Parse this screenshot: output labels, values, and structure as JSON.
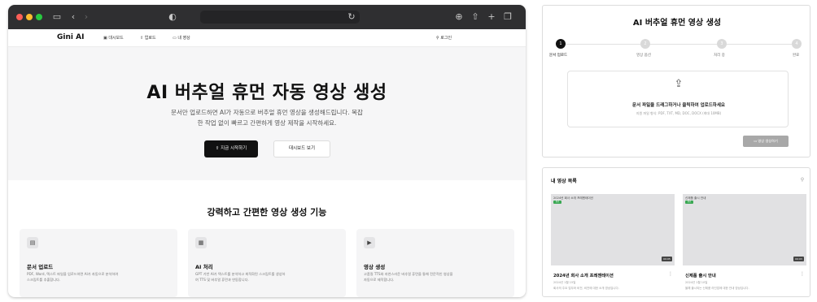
{
  "browser": {
    "nav": {
      "brand": "Gini AI",
      "links": [
        "대시보드",
        "업로드",
        "내 영상"
      ],
      "login": "로그인"
    },
    "hero": {
      "title": "AI 버추얼 휴먼 자동 영상 생성",
      "desc_line1": "문서만 업로드하면 AI가 자동으로 버추얼 휴먼 영상을 생성해드립니다. 복잡",
      "desc_line2": "한 작업 없이 빠르고 간편하게 영상 제작을 시작하세요.",
      "primary_button": "지금 시작하기",
      "secondary_button": "대시보드 보기"
    },
    "features": {
      "title": "강력하고 간편한 영상 생성 기능",
      "cards": [
        {
          "icon": "document-icon",
          "title": "문서 업로드",
          "desc1": "PDF, Word, 텍스트 파일을 업로드하면 AI가 자동으로 분석하여",
          "desc2": "스크립트를 추출합니다."
        },
        {
          "icon": "chip-icon",
          "title": "AI 처리",
          "desc1": "GPT 기반 AI가 텍스트를 분석하고 최적화된 스크립트를 생성하",
          "desc2": "여 TTS 및 버추얼 휴먼과 연동합니다."
        },
        {
          "icon": "video-icon",
          "title": "영상 생성",
          "desc1": "고품질 TTS와 자연스러운 버추얼 휴먼을 통해 전문적인 영상을",
          "desc2": "자동으로 제작합니다."
        }
      ]
    }
  },
  "upload": {
    "title": "AI 버추얼 휴먼 영상 생성",
    "steps": [
      {
        "num": "1",
        "label": "문서 업로드",
        "active": true
      },
      {
        "num": "2",
        "label": "영상 옵션",
        "active": false
      },
      {
        "num": "3",
        "label": "처리 중",
        "active": false
      },
      {
        "num": "4",
        "label": "완료",
        "active": false
      }
    ],
    "drop_text": "문서 파일을 드래그하거나 클릭하여 업로드하세요",
    "drop_sub": "지원 파일 형식: PDF, TXT, MD, DOC, DOCX (최대 10MB)",
    "generate_button": "영상 생성하기"
  },
  "video_list": {
    "title": "내 영상 목록",
    "videos": [
      {
        "thumb_label": "2024년 회사 소개 프레젠테이션",
        "badge": "완료",
        "duration": "00:05",
        "title": "2024년 회사 소개 프레젠테이션",
        "date": "2024년 1월 15일",
        "desc": "회사의 주요 업무와 비전, 비전에 대한 소개 영상입니다."
      },
      {
        "thumb_label": "신제품 출시 안내",
        "badge": "완료",
        "duration": "00:03",
        "title": "신제품 출시 안내",
        "date": "2024년 1월 10일",
        "desc": "올해 출시되는 신제품 라인업에 대한 안내 영상입니다."
      }
    ]
  },
  "colors": {
    "dark": "#111111",
    "hero_bg": "#f6f6f7",
    "badge_green": "#3aa853",
    "chrome": "#2f2f31"
  }
}
